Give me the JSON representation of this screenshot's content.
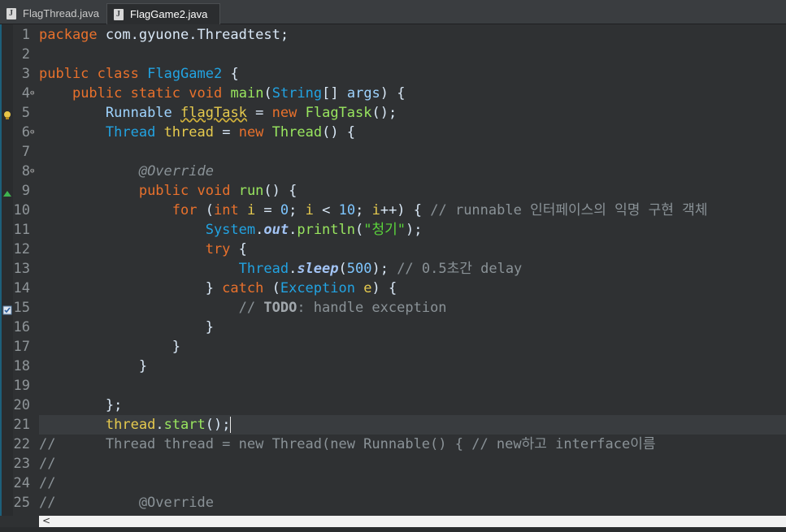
{
  "tabs": [
    {
      "label": "FlagThread.java",
      "active": false
    },
    {
      "label": "FlagGame2.java",
      "active": true
    }
  ],
  "close_glyph": "⨯",
  "lines": [
    {
      "n": "1",
      "tokens": [
        [
          "kw",
          "package"
        ],
        [
          "plain",
          " com.gyuone.Threadtest;"
        ]
      ]
    },
    {
      "n": "2",
      "tokens": []
    },
    {
      "n": "3",
      "tokens": [
        [
          "kw",
          "public"
        ],
        [
          "plain",
          " "
        ],
        [
          "kw",
          "class"
        ],
        [
          "plain",
          " "
        ],
        [
          "cls",
          "FlagGame2"
        ],
        [
          "plain",
          " {"
        ]
      ]
    },
    {
      "n": "4",
      "fold": true,
      "tokens": [
        [
          "plain",
          "    "
        ],
        [
          "kw",
          "public"
        ],
        [
          "plain",
          " "
        ],
        [
          "kw",
          "static"
        ],
        [
          "plain",
          " "
        ],
        [
          "kw",
          "void"
        ],
        [
          "plain",
          " "
        ],
        [
          "meth",
          "main"
        ],
        [
          "plain",
          "("
        ],
        [
          "cls",
          "String"
        ],
        [
          "plain",
          "[] "
        ],
        [
          "type",
          "args"
        ],
        [
          "plain",
          ") {"
        ]
      ]
    },
    {
      "n": "5",
      "marker": "warning",
      "tokens": [
        [
          "plain",
          "        "
        ],
        [
          "type",
          "Runnable"
        ],
        [
          "plain",
          " "
        ],
        [
          "fld squig",
          "flagTask"
        ],
        [
          "plain",
          " = "
        ],
        [
          "kw",
          "new"
        ],
        [
          "plain",
          " "
        ],
        [
          "meth",
          "FlagTask"
        ],
        [
          "plain",
          "();"
        ]
      ]
    },
    {
      "n": "6",
      "fold": true,
      "tokens": [
        [
          "plain",
          "        "
        ],
        [
          "cls",
          "Thread"
        ],
        [
          "plain",
          " "
        ],
        [
          "fld",
          "thread"
        ],
        [
          "plain",
          " = "
        ],
        [
          "kw",
          "new"
        ],
        [
          "plain",
          " "
        ],
        [
          "meth",
          "Thread"
        ],
        [
          "plain",
          "() {"
        ]
      ]
    },
    {
      "n": "7",
      "tokens": []
    },
    {
      "n": "8",
      "fold": true,
      "tokens": [
        [
          "plain",
          "            "
        ],
        [
          "ann",
          "@Override"
        ]
      ]
    },
    {
      "n": "9",
      "marker": "override",
      "tokens": [
        [
          "plain",
          "            "
        ],
        [
          "kw",
          "public"
        ],
        [
          "plain",
          " "
        ],
        [
          "kw",
          "void"
        ],
        [
          "plain",
          " "
        ],
        [
          "meth",
          "run"
        ],
        [
          "plain",
          "() {"
        ]
      ]
    },
    {
      "n": "10",
      "tokens": [
        [
          "plain",
          "                "
        ],
        [
          "kw",
          "for"
        ],
        [
          "plain",
          " ("
        ],
        [
          "kw",
          "int"
        ],
        [
          "plain",
          " "
        ],
        [
          "fld",
          "i"
        ],
        [
          "plain",
          " = "
        ],
        [
          "num",
          "0"
        ],
        [
          "plain",
          "; "
        ],
        [
          "fld",
          "i"
        ],
        [
          "plain",
          " < "
        ],
        [
          "num",
          "10"
        ],
        [
          "plain",
          "; "
        ],
        [
          "fld",
          "i"
        ],
        [
          "plain",
          "++) { "
        ],
        [
          "cmt",
          "// runnable 인터페이스의 익명 구현 객체"
        ]
      ]
    },
    {
      "n": "11",
      "tokens": [
        [
          "plain",
          "                    "
        ],
        [
          "cls",
          "System"
        ],
        [
          "plain",
          "."
        ],
        [
          "ital",
          "out"
        ],
        [
          "plain",
          "."
        ],
        [
          "meth",
          "println"
        ],
        [
          "plain",
          "("
        ],
        [
          "str",
          "\"청기\""
        ],
        [
          "plain",
          ");"
        ]
      ]
    },
    {
      "n": "12",
      "tokens": [
        [
          "plain",
          "                    "
        ],
        [
          "kw",
          "try"
        ],
        [
          "plain",
          " {"
        ]
      ]
    },
    {
      "n": "13",
      "tokens": [
        [
          "plain",
          "                        "
        ],
        [
          "cls",
          "Thread"
        ],
        [
          "plain",
          "."
        ],
        [
          "ital",
          "sleep"
        ],
        [
          "plain",
          "("
        ],
        [
          "num",
          "500"
        ],
        [
          "plain",
          "); "
        ],
        [
          "cmt",
          "// 0.5초간 delay"
        ]
      ]
    },
    {
      "n": "14",
      "tokens": [
        [
          "plain",
          "                    } "
        ],
        [
          "kw",
          "catch"
        ],
        [
          "plain",
          " ("
        ],
        [
          "cls",
          "Exception"
        ],
        [
          "plain",
          " "
        ],
        [
          "fld",
          "e"
        ],
        [
          "plain",
          ") {"
        ]
      ]
    },
    {
      "n": "15",
      "marker": "task",
      "tokens": [
        [
          "plain",
          "                        "
        ],
        [
          "cmt",
          "// "
        ],
        [
          "bold",
          "TODO"
        ],
        [
          "cmt",
          ": handle exception"
        ]
      ]
    },
    {
      "n": "16",
      "tokens": [
        [
          "plain",
          "                    }"
        ]
      ]
    },
    {
      "n": "17",
      "tokens": [
        [
          "plain",
          "                }"
        ]
      ]
    },
    {
      "n": "18",
      "tokens": [
        [
          "plain",
          "            }"
        ]
      ]
    },
    {
      "n": "19",
      "tokens": []
    },
    {
      "n": "20",
      "tokens": [
        [
          "plain",
          "        };"
        ]
      ]
    },
    {
      "n": "21",
      "current": true,
      "tokens": [
        [
          "plain",
          "        "
        ],
        [
          "fld",
          "thread"
        ],
        [
          "plain",
          "."
        ],
        [
          "meth",
          "start"
        ],
        [
          "plain",
          "();"
        ]
      ]
    },
    {
      "n": "22",
      "tokens": [
        [
          "cmt",
          "//      Thread thread = new Thread(new Runnable() { // new하고 interface이름"
        ]
      ]
    },
    {
      "n": "23",
      "tokens": [
        [
          "cmt",
          "//"
        ]
      ]
    },
    {
      "n": "24",
      "tokens": [
        [
          "cmt",
          "//"
        ]
      ]
    },
    {
      "n": "25",
      "tokens": [
        [
          "cmt",
          "//          @Override"
        ]
      ]
    }
  ],
  "scroll_left_arrow": "<"
}
